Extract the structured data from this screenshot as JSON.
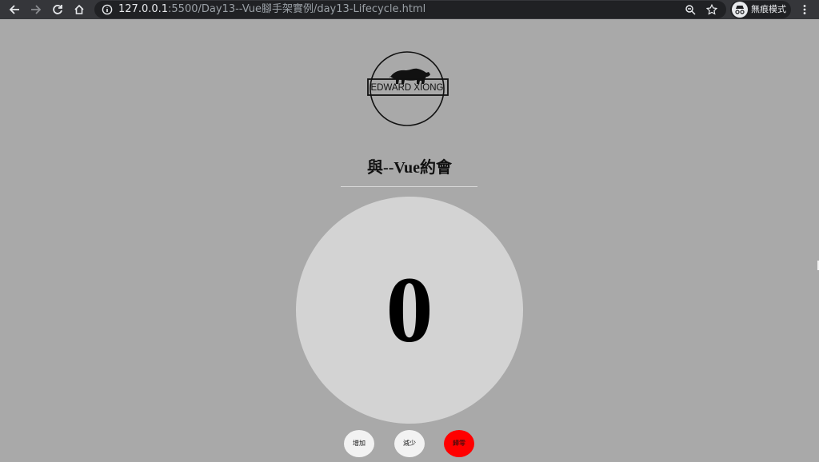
{
  "browser": {
    "url_host": "127.0.0.1",
    "url_rest": ":5500/Day13--Vue腳手架實例/day13-Lifecycle.html",
    "profile_label": "無痕模式",
    "icons": [
      "back-icon",
      "forward-icon",
      "reload-icon",
      "home-icon",
      "info-icon",
      "zoom-icon",
      "star-icon",
      "incognito-icon",
      "menu-icon"
    ]
  },
  "logo": {
    "text": "EDWARD XIONG"
  },
  "page": {
    "title": "與--Vue約會"
  },
  "counter": {
    "value": "0"
  },
  "buttons": {
    "add_label": "增加",
    "sub_label": "減少",
    "reset_label": "歸零"
  },
  "colors": {
    "page_bg": "#a9a9a9",
    "circle_bg": "#d3d3d3",
    "reset_button": "#ff0000",
    "button_bg": "#f2f2f2"
  }
}
